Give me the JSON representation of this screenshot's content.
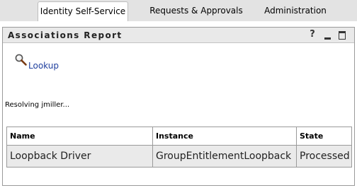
{
  "tabs": [
    {
      "label": "Identity Self-Service",
      "active": true
    },
    {
      "label": "Requests & Approvals",
      "active": false
    },
    {
      "label": "Administration",
      "active": false
    }
  ],
  "portlet": {
    "title": "Associations Report",
    "help_label": "?"
  },
  "lookup": {
    "icon": "magnifier-icon",
    "label": "Lookup"
  },
  "status_text": "Resolving jmiller...",
  "table": {
    "headers": [
      "Name",
      "Instance",
      "State"
    ],
    "rows": [
      [
        "Loopback Driver",
        "GroupEntitlementLoopback",
        "Processed"
      ]
    ]
  },
  "colors": {
    "tabbar_bg": "#e3e3e3",
    "header_bg": "#e9e9e9",
    "link": "#1f3f9e",
    "row_bg": "#eaeaea",
    "border": "#9a9a9a"
  }
}
